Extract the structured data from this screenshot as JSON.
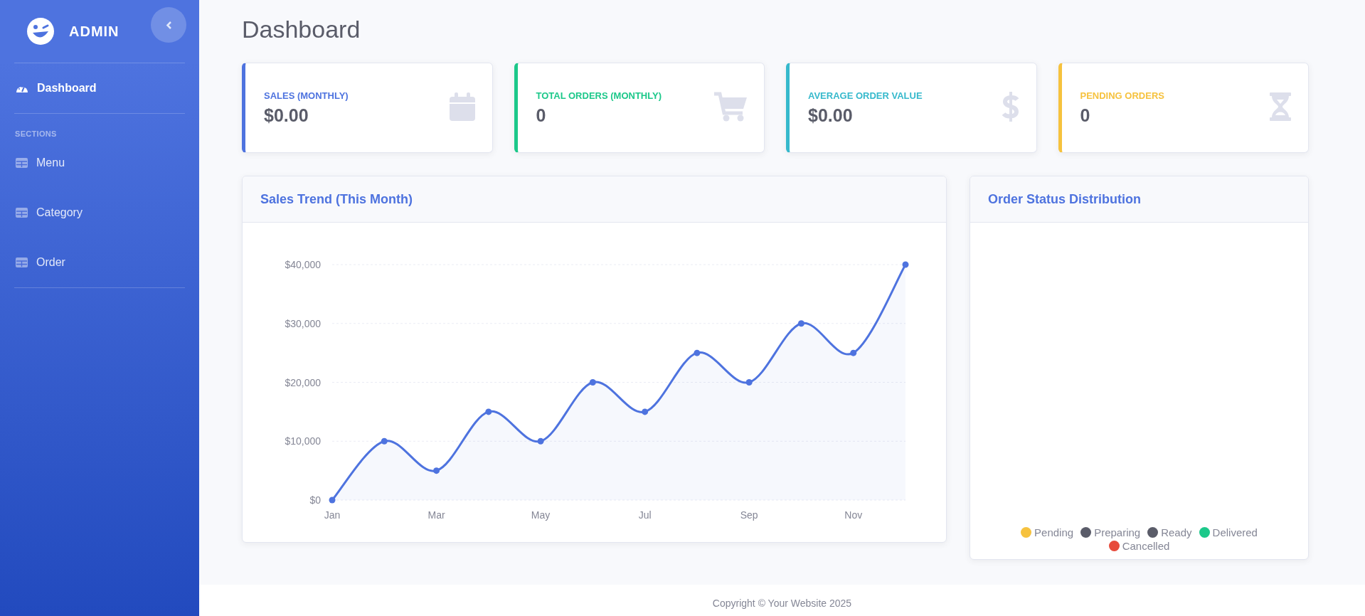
{
  "sidebar": {
    "brand": "ADMIN",
    "heading": "SECTIONS",
    "items": [
      {
        "label": "Dashboard",
        "selected": true,
        "kind": "dashboard"
      },
      {
        "label": "Menu",
        "selected": false,
        "kind": "section"
      },
      {
        "label": "Category",
        "selected": false,
        "kind": "section"
      },
      {
        "label": "Order",
        "selected": false,
        "kind": "section"
      }
    ]
  },
  "page_title": "Dashboard",
  "stat_cards": [
    {
      "label": "SALES (MONTHLY)",
      "value": "$0.00",
      "color": "#4e73df"
    },
    {
      "label": "TOTAL ORDERS (MONTHLY)",
      "value": "0",
      "color": "#1cc88a"
    },
    {
      "label": "AVERAGE ORDER VALUE",
      "value": "$0.00",
      "color": "#36b9cc"
    },
    {
      "label": "PENDING ORDERS",
      "value": "0",
      "color": "#f6c23e"
    }
  ],
  "sales_trend": {
    "title": "Sales Trend (This Month)",
    "chart_data": {
      "type": "area",
      "categories": [
        "Jan",
        null,
        "Mar",
        null,
        "May",
        null,
        "Jul",
        null,
        "Sep",
        null,
        "Nov",
        null
      ],
      "series": [
        {
          "color": "#4e73df",
          "values": [
            0,
            10000,
            5000,
            15000,
            10000,
            20000,
            15000,
            25000,
            20000,
            30000,
            25000,
            40000
          ]
        }
      ],
      "ylim": [
        0,
        40000
      ],
      "grid": true,
      "yticks": [
        {
          "value": 0,
          "label": "$0"
        },
        {
          "value": 10000,
          "label": "$10,000"
        },
        {
          "value": 20000,
          "label": "$20,000"
        },
        {
          "value": 30000,
          "label": "$30,000"
        },
        {
          "value": 40000,
          "label": "$40,000"
        }
      ]
    }
  },
  "order_status": {
    "title": "Order Status Distribution",
    "legend": [
      {
        "label": "Pending",
        "color": "#f6c23e"
      },
      {
        "label": "Preparing",
        "color": "#5a5c69"
      },
      {
        "label": "Ready",
        "color": "#5a5c69"
      },
      {
        "label": "Delivered",
        "color": "#1cc88a"
      },
      {
        "label": "Cancelled",
        "color": "#e74a3b"
      }
    ]
  },
  "footer": "Copyright © Your Website 2025"
}
